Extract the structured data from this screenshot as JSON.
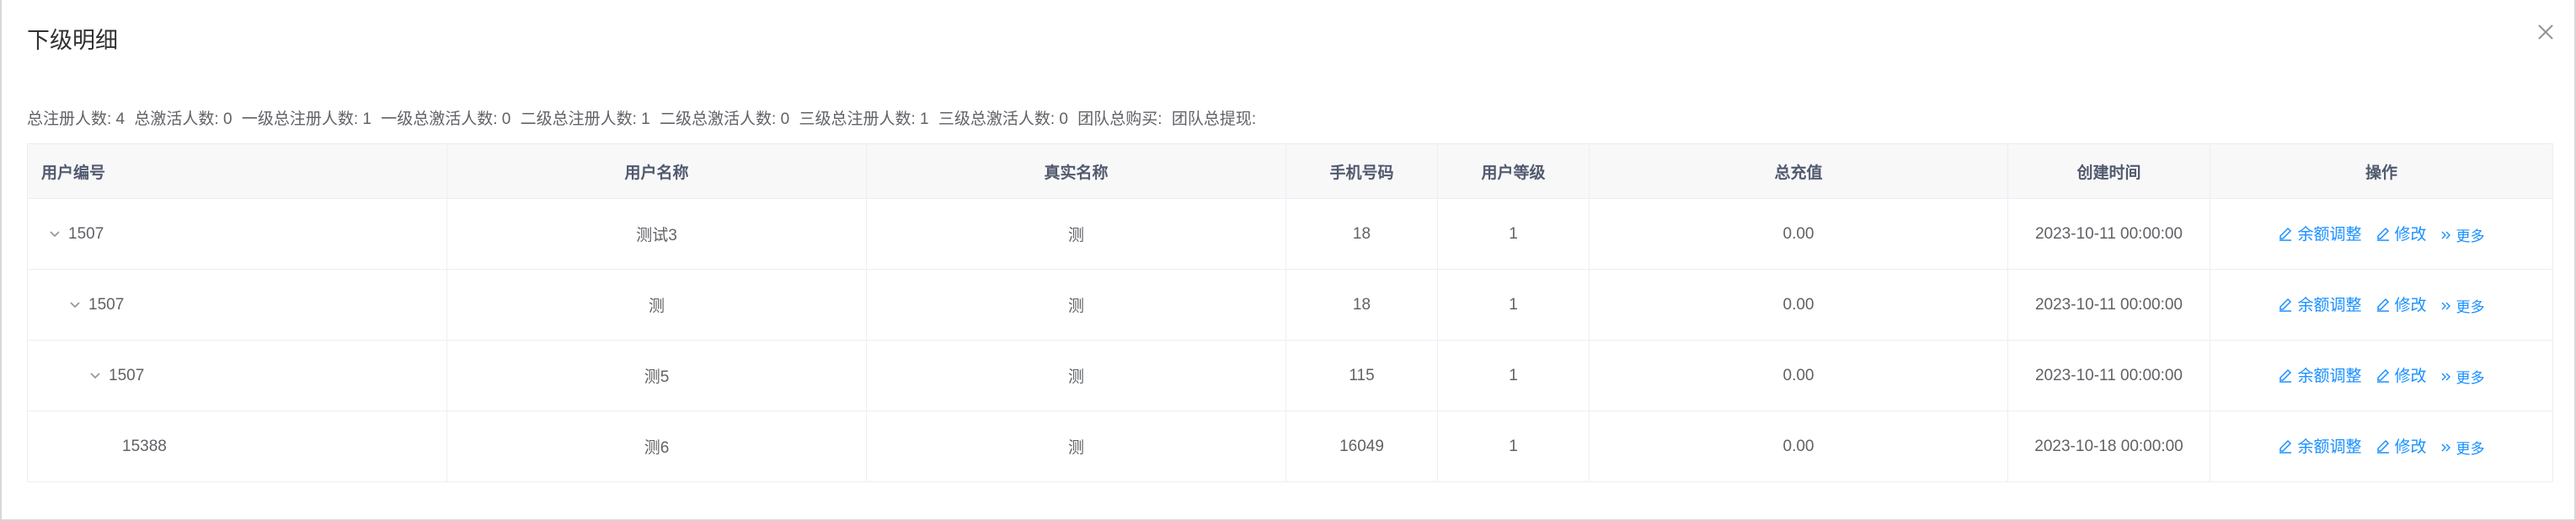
{
  "dialog": {
    "title": "下级明细"
  },
  "summary": [
    "总注册人数: 4",
    "总激活人数: 0",
    "一级总注册人数: 1",
    "一级总激活人数: 0",
    "二级总注册人数: 1",
    "二级总激活人数: 0",
    "三级总注册人数: 1",
    "三级总激活人数: 0",
    "团队总购买:",
    "团队总提现:"
  ],
  "table": {
    "headers": [
      "用户编号",
      "用户名称",
      "真实名称",
      "手机号码",
      "用户等级",
      "总充值",
      "创建时间",
      "操作"
    ],
    "rows": [
      {
        "id": "1507",
        "username": "测试3",
        "realname": "测",
        "phone": "18",
        "level": "1",
        "recharge": "0.00",
        "created": "2023-10-11 00:00:00"
      },
      {
        "id": "1507",
        "username": "测",
        "realname": "测",
        "phone": "18",
        "level": "1",
        "recharge": "0.00",
        "created": "2023-10-11 00:00:00"
      },
      {
        "id": "1507",
        "username": "测5",
        "realname": "测",
        "phone": "115",
        "level": "1",
        "recharge": "0.00",
        "created": "2023-10-11 00:00:00"
      },
      {
        "id": "15388",
        "username": "测6",
        "realname": "测",
        "phone": "16049",
        "level": "1",
        "recharge": "0.00",
        "created": "2023-10-18 00:00:00"
      }
    ],
    "actions": {
      "balance": "余额调整",
      "edit": "修改",
      "more": "更多"
    }
  },
  "colors": {
    "accent": "#1890ff",
    "header_bg": "#f8f8f9",
    "border": "#ebeef5"
  },
  "icons": {
    "close": "close-icon",
    "expand": "chevron-down-icon",
    "edit": "edit-icon",
    "more": "double-chevron-right-icon"
  }
}
